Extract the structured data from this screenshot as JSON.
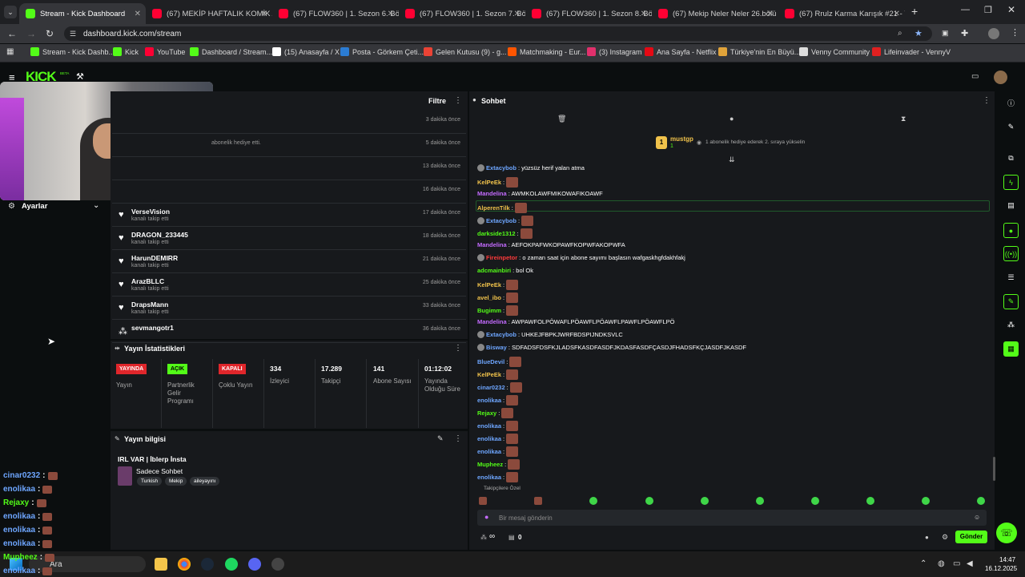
{
  "browser": {
    "tabs": [
      {
        "title": "Stream - Kick Dashboard",
        "fav": "#53fc18"
      },
      {
        "title": "(67) MEKİP HAFTALIK KOMİK A",
        "fav": "#ff0033"
      },
      {
        "title": "(67) FLOW360 | 1. Sezon 6. Böl",
        "fav": "#ff0033"
      },
      {
        "title": "(67) FLOW360 | 1. Sezon 7. Böl",
        "fav": "#ff0033"
      },
      {
        "title": "(67) FLOW360 | 1. Sezon 8. Bölü",
        "fav": "#ff0033"
      },
      {
        "title": "(67) Mekip Neler Neler 26.bölü",
        "fav": "#ff0033"
      },
      {
        "title": "(67) Rrulz Karma Karışık #21 - Y",
        "fav": "#ff0033"
      }
    ],
    "url": "dashboard.kick.com/stream",
    "bookmarks": [
      {
        "label": "Stream - Kick Dashb...",
        "c": "#53fc18"
      },
      {
        "label": "Kick",
        "c": "#53fc18"
      },
      {
        "label": "YouTube",
        "c": "#ff0033"
      },
      {
        "label": "Dashboard / Stream...",
        "c": "#53fc18"
      },
      {
        "label": "(15) Anasayfa / X",
        "c": "#ffffff"
      },
      {
        "label": "Posta - Görkem Çeti...",
        "c": "#2b7cd3"
      },
      {
        "label": "Gelen Kutusu (9) - g...",
        "c": "#ea4335"
      },
      {
        "label": "Matchmaking - Eur...",
        "c": "#ff5500"
      },
      {
        "label": "(3) Instagram",
        "c": "#e1306c"
      },
      {
        "label": "Ana Sayfa - Netflix",
        "c": "#e50914"
      },
      {
        "label": "Türkiye'nin En Büyü...",
        "c": "#e0a33a"
      },
      {
        "label": "Venny Community",
        "c": "#dddddd"
      },
      {
        "label": "Lifeinvader - VennyV",
        "c": "#e02020"
      }
    ]
  },
  "app": {
    "logo": "KICK",
    "beta": "BETA"
  },
  "activity": {
    "title": "Filtre",
    "top_items": [
      {
        "sub": "",
        "time": "3 dakika önce"
      },
      {
        "sub": "abonelik hediye etti.",
        "time": "5 dakika önce"
      },
      {
        "sub": "",
        "time": "13 dakika önce"
      },
      {
        "sub": "",
        "time": "16 dakika önce"
      }
    ],
    "items": [
      {
        "name": "VerseVision",
        "sub": "kanalı takip etti",
        "time": "17 dakika önce"
      },
      {
        "name": "DRAGON_233445",
        "sub": "kanalı takip etti",
        "time": "18 dakika önce"
      },
      {
        "name": "HarunDEMIRR",
        "sub": "kanalı takip etti",
        "time": "21 dakika önce"
      },
      {
        "name": "ArazBLLC",
        "sub": "kanalı takip etti",
        "time": "25 dakika önce"
      },
      {
        "name": "DrapsMann",
        "sub": "kanalı takip etti",
        "time": "33 dakika önce"
      },
      {
        "name": "sevmangotr1",
        "sub": "",
        "time": "36 dakika önce"
      }
    ]
  },
  "settings": {
    "label": "Ayarlar"
  },
  "stats": {
    "title": "Yayın İstatistikleri",
    "badges": [
      {
        "text": "YAYINDA",
        "label": "Yayın"
      },
      {
        "text": "AÇIK",
        "label": "Partnerlik Gelir Programı"
      },
      {
        "text": "KAPALI",
        "label": "Çoklu Yayın"
      }
    ],
    "values": [
      {
        "v": "334",
        "l": "İzleyici"
      },
      {
        "v": "17.289",
        "l": "Takipçi"
      },
      {
        "v": "141",
        "l": "Abone Sayısı"
      },
      {
        "v": "01:12:02",
        "l": "Yayında Olduğu Süre"
      }
    ]
  },
  "info": {
    "title": "Yayın bilgisi",
    "stream_title": "IRL VAR | İblerp İnsta",
    "category": "Sadece Sohbet",
    "tags": [
      "Turkish",
      "Mekip",
      "aileyayını"
    ]
  },
  "chat": {
    "title": "Sohbet",
    "pinned_user": "mustgp",
    "pinned_count": "1",
    "pinned_text": "1 abonelik hediye ederek 2. sıraya yükselin",
    "messages": [
      {
        "u": "Extacybob",
        "c": "#6ea6ff",
        "t": ": yüzsüz herif yalan atma",
        "em": 0
      },
      {
        "u": "KelPeEk",
        "c": "#f0c24b",
        "t": ":",
        "em": 1
      },
      {
        "u": "Mandelina",
        "c": "#c46bff",
        "t": ": AWMKOLAWFMIKOWAFIKOAWF",
        "em": 0
      },
      {
        "u": "AlperenTilk",
        "c": "#f0c24b",
        "t": ":",
        "em": 1
      },
      {
        "u": "Extacybob",
        "c": "#6ea6ff",
        "t": ":",
        "em": 1
      },
      {
        "u": "darkside1312",
        "c": "#53fc18",
        "t": ":",
        "em": 1
      },
      {
        "u": "Mandelina",
        "c": "#c46bff",
        "t": ": AEFOKPAFWKOPAWFKOPWFAKOPWFA",
        "em": 0
      },
      {
        "u": "Fireinpetor",
        "c": "#ff3b3b",
        "t": ": o zaman saat için abone sayımı başlasın wafgaskhgfdakhfakj",
        "em": 0
      },
      {
        "u": "adcmainbiri",
        "c": "#53fc18",
        "t": ": bol Ok",
        "em": 0
      },
      {
        "u": "KelPeEk",
        "c": "#f0c24b",
        "t": ":",
        "em": 1
      },
      {
        "u": "avel_ibo",
        "c": "#f0c24b",
        "t": ":",
        "em": 1
      },
      {
        "u": "Bugimm",
        "c": "#53fc18",
        "t": ":",
        "em": 1
      },
      {
        "u": "Mandelina",
        "c": "#c46bff",
        "t": ": AWPAWFOLPÖWAFLPÖAWFLPÖAWFLPAWFLPÖAWFLPÖ",
        "em": 0
      },
      {
        "u": "Extacybob",
        "c": "#6ea6ff",
        "t": ": UHKEJFBPKJWRFBDSPIJNDKSVLC",
        "em": 0
      },
      {
        "u": "Bisway",
        "c": "#6ea6ff",
        "t": ": SDFADSFDSFKJLADSFKASDFASDFJKDASFASDFÇASDJFHADSFKÇJASDFJKASDF",
        "em": 0
      },
      {
        "u": "BlueDevil",
        "c": "#6ea6ff",
        "t": ":",
        "em": 1
      },
      {
        "u": "KelPeEk",
        "c": "#f0c24b",
        "t": ":",
        "em": 1
      },
      {
        "u": "cinar0232",
        "c": "#6ea6ff",
        "t": ":",
        "em": 1
      },
      {
        "u": "enolikaa",
        "c": "#6ea6ff",
        "t": ":",
        "em": 1
      },
      {
        "u": "Rejaxy",
        "c": "#53fc18",
        "t": ":",
        "em": 1
      },
      {
        "u": "enolikaa",
        "c": "#6ea6ff",
        "t": ":",
        "em": 1
      },
      {
        "u": "enolikaa",
        "c": "#6ea6ff",
        "t": ":",
        "em": 1
      },
      {
        "u": "enolikaa",
        "c": "#6ea6ff",
        "t": ":",
        "em": 1
      },
      {
        "u": "Mupheez",
        "c": "#53fc18",
        "t": ":",
        "em": 1
      },
      {
        "u": "enolikaa",
        "c": "#6ea6ff",
        "t": ":",
        "em": 1
      }
    ],
    "emote_label": "Takipçilere Özel",
    "placeholder": "Bir mesaj gönderin",
    "infinity": "∞",
    "count": "0",
    "send": "Gönder"
  },
  "overlay_chat": [
    {
      "u": "cinar0232",
      "c": "#6ea6ff"
    },
    {
      "u": "enolikaa",
      "c": "#6ea6ff"
    },
    {
      "u": "Rejaxy",
      "c": "#53fc18"
    },
    {
      "u": "enolikaa",
      "c": "#6ea6ff"
    },
    {
      "u": "enolikaa",
      "c": "#6ea6ff"
    },
    {
      "u": "enolikaa",
      "c": "#6ea6ff"
    },
    {
      "u": "Mupheez",
      "c": "#53fc18"
    },
    {
      "u": "enolikaa",
      "c": "#6ea6ff"
    }
  ],
  "taskbar": {
    "search": "Ara",
    "time": "14:47",
    "date": "16.12.2025"
  }
}
